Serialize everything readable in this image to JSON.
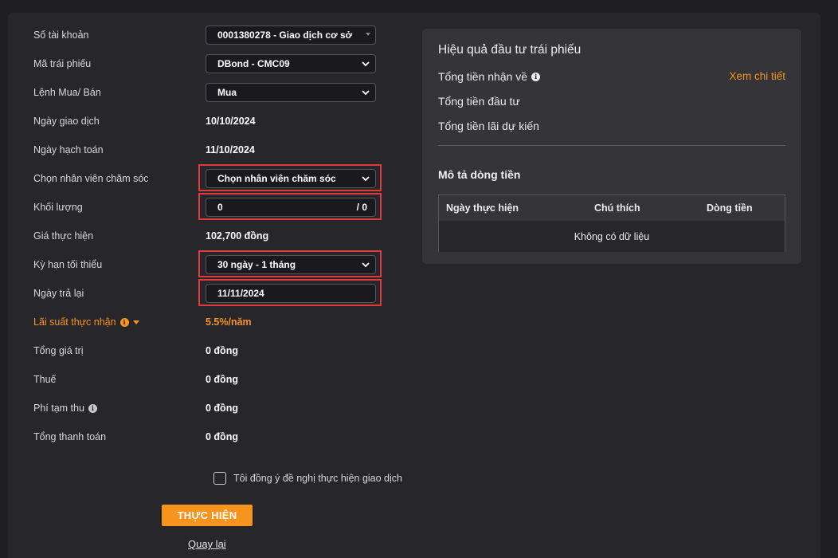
{
  "form": {
    "account": {
      "label": "Số tài khoản",
      "value": "0001380278 - Giao dịch cơ sở"
    },
    "bond_code": {
      "label": "Mã trái phiếu",
      "value": "DBond - CMC09"
    },
    "order_type": {
      "label": "Lệnh Mua/ Bán",
      "value": "Mua"
    },
    "trade_date": {
      "label": "Ngày giao dịch",
      "value": "10/10/2024"
    },
    "accounting_date": {
      "label": "Ngày hạch toán",
      "value": "11/10/2024"
    },
    "care_staff": {
      "label": "Chọn nhân viên chăm sóc",
      "value": "Chọn nhân viên chăm sóc"
    },
    "quantity": {
      "label": "Khối lượng",
      "value": "0",
      "suffix": "/ 0"
    },
    "price": {
      "label": "Giá thực hiện",
      "value": "102,700 đồng"
    },
    "min_term": {
      "label": "Kỳ hạn tối thiểu",
      "value": "30 ngày - 1 tháng"
    },
    "return_date": {
      "label": "Ngày trả lại",
      "value": "11/11/2024"
    },
    "rate": {
      "label": "Lãi suất thực nhận",
      "value": "5.5%/năm"
    },
    "total_value": {
      "label": "Tổng giá trị",
      "value": "0 đồng"
    },
    "tax": {
      "label": "Thuế",
      "value": "0 đồng"
    },
    "temp_fee": {
      "label": "Phí tạm thu",
      "value": "0 đồng"
    },
    "total_payment": {
      "label": "Tổng thanh toán",
      "value": "0 đồng"
    }
  },
  "agree_label": "Tôi đồng ý đề nghị thực hiện giao dịch",
  "submit_label": "THỰC HIỆN",
  "back_label": "Quay lại",
  "summary": {
    "title": "Hiệu quả đầu tư trái phiếu",
    "total_received": "Tổng tiền nhận về",
    "detail_link": "Xem chi tiết",
    "total_invested": "Tổng tiền đầu tư",
    "expected_interest": "Tổng tiền lãi dự kiến",
    "cashflow_title": "Mô tả dòng tiền",
    "columns": [
      "Ngày thực hiện",
      "Chú thích",
      "Dòng tiền"
    ],
    "empty_text": "Không có dữ liệu"
  },
  "colors": {
    "accent": "#f7941d",
    "highlight": "#e03a3a",
    "background": "#1f1f23",
    "panel": "#26262b"
  },
  "icons": {
    "info": "info-icon",
    "dropdown": "chevron-down-icon"
  }
}
